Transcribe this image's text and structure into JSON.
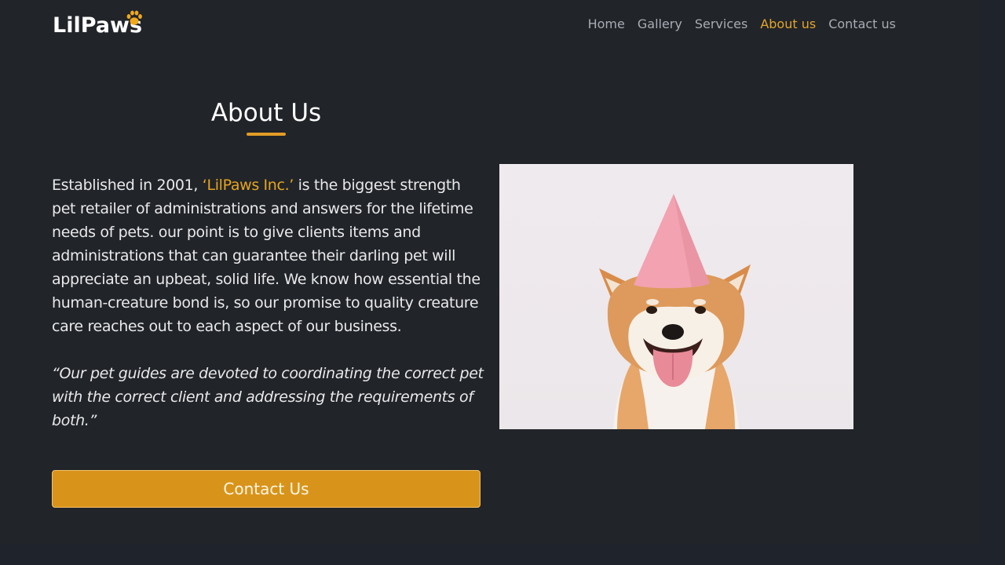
{
  "brand": {
    "logo_text": "LilPaws",
    "accent_color": "#e2a52c"
  },
  "nav": {
    "items": [
      {
        "label": "Home",
        "active": false
      },
      {
        "label": "Gallery",
        "active": false
      },
      {
        "label": "Services",
        "active": false
      },
      {
        "label": "About us",
        "active": true
      },
      {
        "label": "Contact us",
        "active": false
      }
    ]
  },
  "about": {
    "title": "About Us",
    "intro_before": "Established in 2001, ",
    "company_name": "‘LilPaws Inc.’",
    "intro_after": " is the biggest strength pet retailer of administrations and answers for the lifetime needs of pets. our point is to give clients items and administrations that can guarantee their darling pet will appreciate an upbeat, solid life. We know how essential the human-creature bond is, so our promise to quality creature care reaches out to each aspect of our business.",
    "quote": "“Our pet guides are devoted to coordinating the correct pet with the correct client and addressing the requirements of both.”",
    "button_label": "Contact Us",
    "image_alt": "Shiba Inu dog wearing a pink party hat"
  }
}
